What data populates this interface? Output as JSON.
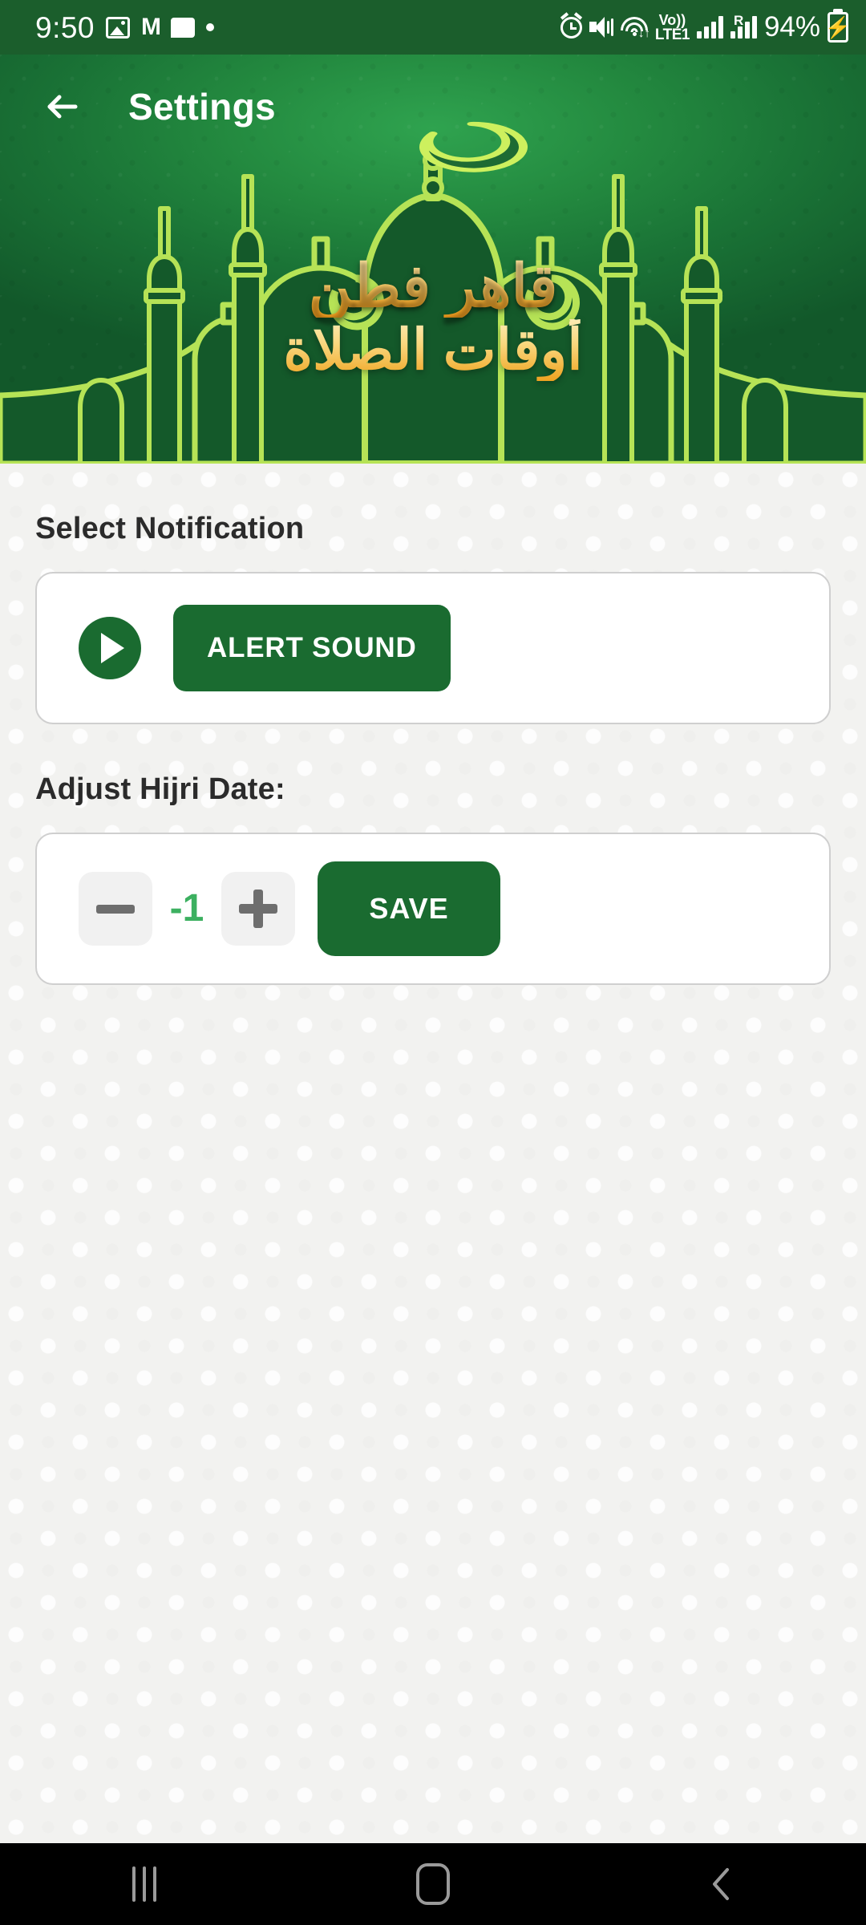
{
  "status_bar": {
    "time": "9:50",
    "left_icons": [
      "photo-icon",
      "gmail-icon",
      "message-icon",
      "dot-icon"
    ],
    "gmail_glyph": "M",
    "volte_top": "Vo))",
    "volte_bottom": "LTE1",
    "roaming_label": "R",
    "battery_percent": "94%",
    "right_icons": [
      "alarm-icon",
      "mute-vibrate-icon",
      "wifi-icon",
      "volte-icon",
      "signal-bars-icon",
      "roaming-signal-icon",
      "battery-charging-icon"
    ],
    "background_color": "#1b5e2c"
  },
  "header": {
    "back_label": "back-arrow",
    "title": "Settings",
    "arabic_line1": "قاهر فطن",
    "arabic_line2": "أوقات الصلاة",
    "banner_green_light": "#2fa34f",
    "banner_green_dark": "#12582a",
    "accent_gold": "#f2b43e",
    "mosque_outline": "#b6e356"
  },
  "main": {
    "notification": {
      "section_label": "Select Notification",
      "play_icon": "play-icon",
      "alert_button_label": "ALERT SOUND"
    },
    "hijri": {
      "section_label": "Adjust Hijri Date:",
      "decrement_icon": "minus-icon",
      "value": "-1",
      "increment_icon": "plus-icon",
      "save_button_label": "SAVE",
      "value_color": "#3cb060",
      "button_color": "#1a6b30"
    }
  },
  "nav_bar": {
    "recents_icon": "recents-icon",
    "home_icon": "home-icon",
    "back_icon": "back-chevron-icon"
  }
}
